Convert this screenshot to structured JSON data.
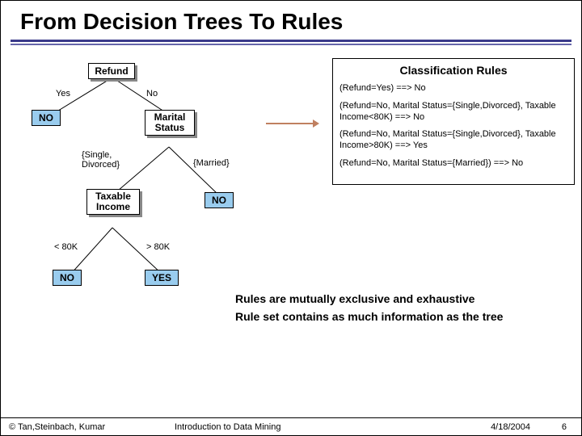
{
  "title": "From Decision Trees To Rules",
  "tree": {
    "root": "Refund",
    "root_left_label": "Yes",
    "root_right_label": "No",
    "leaf_no_1": "NO",
    "node_marital": "Marital\nStatus",
    "marital_left_label": "{Single,\nDivorced}",
    "marital_right_label": "{Married}",
    "node_taxable": "Taxable\nIncome",
    "leaf_no_2": "NO",
    "tax_left_label": "< 80K",
    "tax_right_label": "> 80K",
    "leaf_no_3": "NO",
    "leaf_yes": "YES"
  },
  "rules": {
    "heading": "Classification Rules",
    "r1": "(Refund=Yes) ==> No",
    "r2": "(Refund=No, Marital Status={Single,Divorced}, Taxable Income<80K) ==> No",
    "r3": "(Refund=No, Marital Status={Single,Divorced}, Taxable Income>80K) ==> Yes",
    "r4": "(Refund=No, Marital Status={Married}) ==> No"
  },
  "notes": {
    "n1": "Rules are mutually exclusive and exhaustive",
    "n2": "Rule set contains as much information as the tree"
  },
  "footer": {
    "copyright": "© Tan,Steinbach, Kumar",
    "course": "Introduction to Data Mining",
    "date": "4/18/2004",
    "page": "6"
  }
}
